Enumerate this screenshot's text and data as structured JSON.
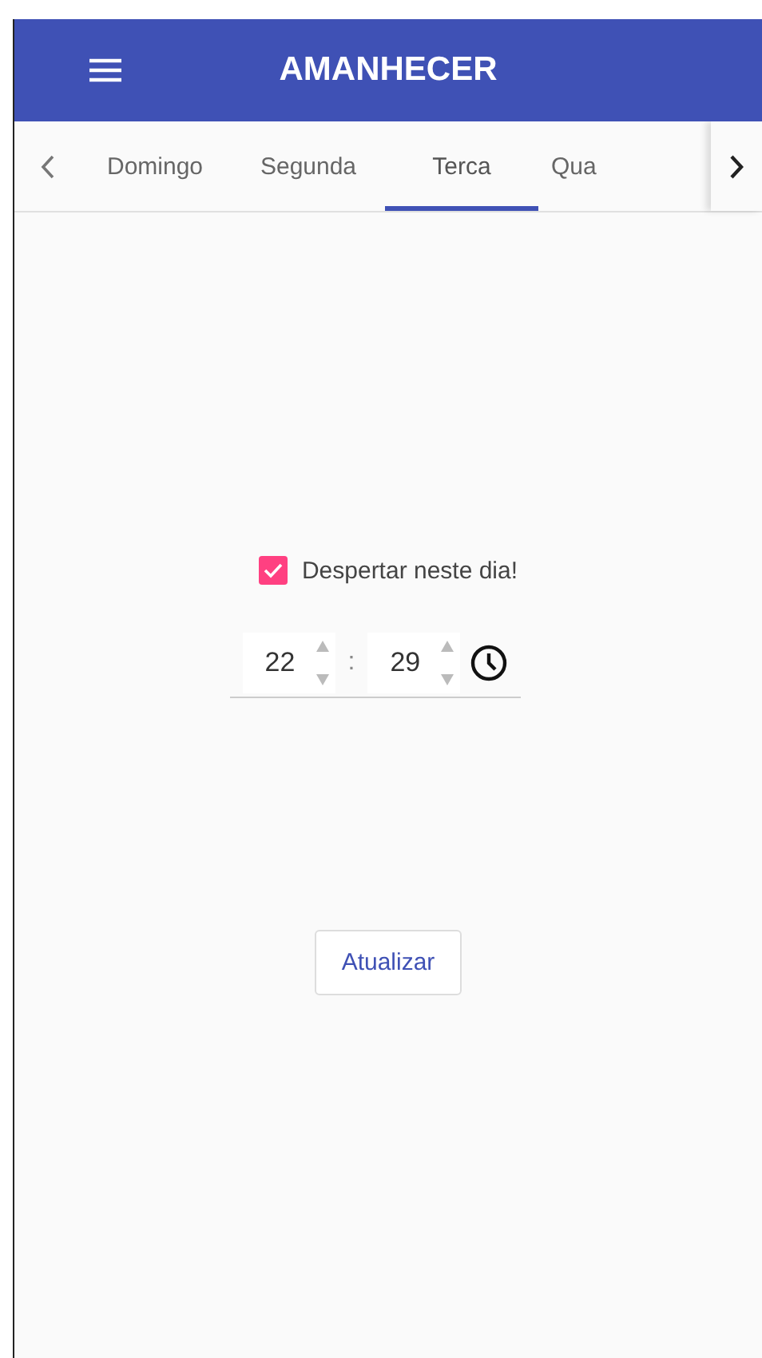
{
  "app_bar": {
    "title": "AMANHECER"
  },
  "tabs": [
    {
      "label": "Domingo",
      "selected": false
    },
    {
      "label": "Segunda",
      "selected": false
    },
    {
      "label": "Terca",
      "selected": true
    },
    {
      "label": "Qua",
      "selected": false
    }
  ],
  "wake_checkbox": {
    "label": "Despertar neste dia!",
    "checked": true
  },
  "time": {
    "hours": "22",
    "separator": ":",
    "minutes": "29"
  },
  "update_button": {
    "label": "Atualizar"
  }
}
